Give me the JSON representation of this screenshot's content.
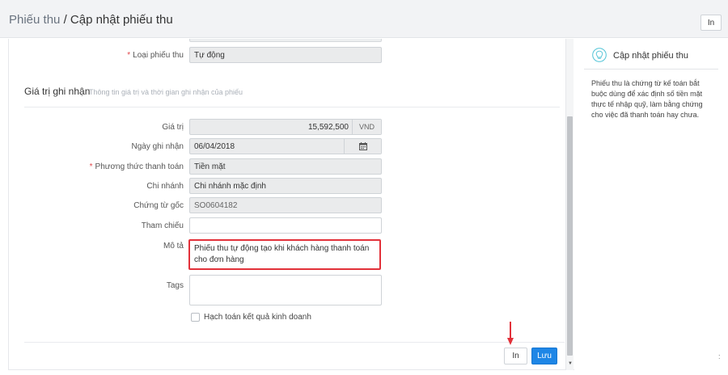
{
  "header": {
    "breadcrumb_parent": "Phiếu thu",
    "separator": "/",
    "breadcrumb_current": "Cập nhật phiếu thu",
    "print_label": "In"
  },
  "form": {
    "loai_phieu": {
      "label": "Loại phiếu thu",
      "value": "Tự động",
      "required": true
    },
    "section": {
      "title": "Giá trị ghi nhận",
      "subtitle": "Thông tin giá trị và thời gian ghi nhận của phiếu"
    },
    "gia_tri": {
      "label": "Giá trị",
      "value": "15,592,500",
      "unit": "VND"
    },
    "ngay_ghi_nhan": {
      "label": "Ngày ghi nhận",
      "value": "06/04/2018"
    },
    "phuong_thuc": {
      "label": "Phương thức thanh toán",
      "value": "Tiền mặt",
      "required": true
    },
    "chi_nhanh": {
      "label": "Chi nhánh",
      "value": "Chi nhánh mặc định"
    },
    "chung_tu_goc": {
      "label": "Chứng từ gốc",
      "value": "SO0604182"
    },
    "tham_chieu": {
      "label": "Tham chiếu",
      "value": ""
    },
    "mo_ta": {
      "label": "Mô tả",
      "value": "Phiếu thu tự động tạo khi khách hàng thanh toán cho đơn hàng"
    },
    "tags": {
      "label": "Tags",
      "value": ""
    },
    "hach_toan": {
      "label": "Hạch toán kết quả kinh doanh",
      "checked": false
    }
  },
  "footer": {
    "print_label": "In",
    "save_label": "Lưu"
  },
  "sidebar": {
    "title": "Cập nhật phiếu thu",
    "description": "Phiếu thu là chứng từ kế toán bắt buộc dùng để xác định số tiền mặt thực tế nhập quỹ, làm bằng chứng cho việc đã thanh toán hay chưa."
  },
  "colors": {
    "primary": "#1e86e6",
    "required": "#e2474b",
    "highlight_border": "#e2313a",
    "accent_icon": "#4fc3d6"
  },
  "icons": {
    "calendar": "calendar-icon",
    "lightbulb": "lightbulb-icon",
    "arrow": "arrow-down-icon"
  }
}
